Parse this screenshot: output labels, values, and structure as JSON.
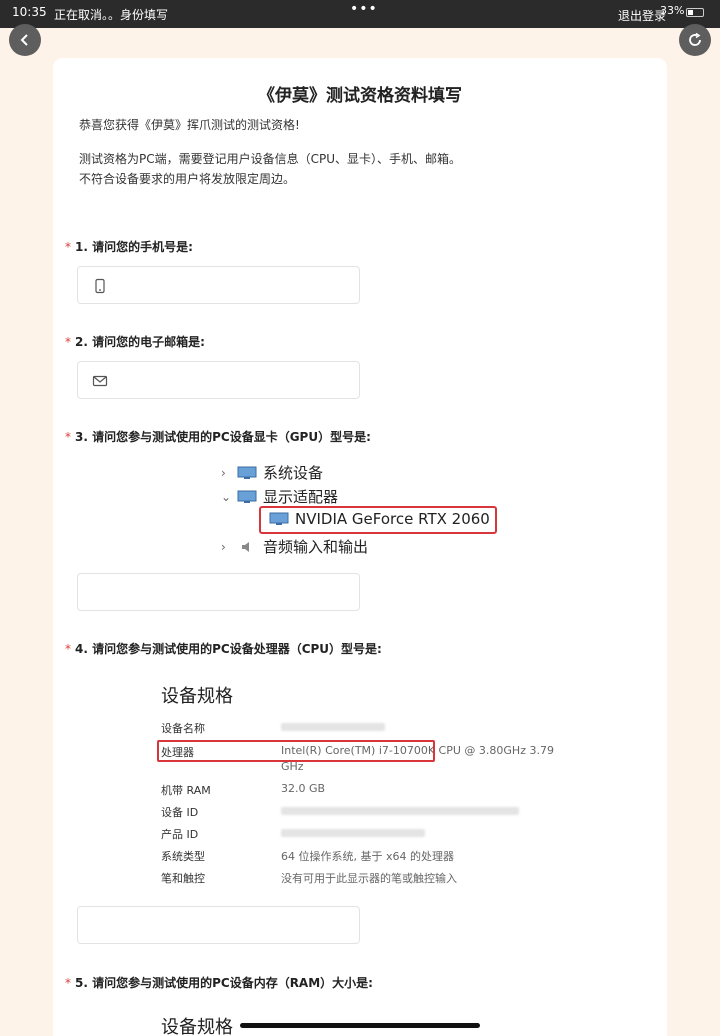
{
  "status_bar": {
    "time": "10:35",
    "tab_text": "正在取消。。身份填写",
    "dots": "•••",
    "logout": "退出登录",
    "battery": "33%"
  },
  "form": {
    "title": "《伊莫》测试资格资料填写",
    "intro_line1": "恭喜您获得《伊莫》挥爪测试的测试资格!",
    "intro_line2": "测试资格为PC端，需要登记用户设备信息（CPU、显卡）、手机、邮箱。",
    "intro_line3": "不符合设备要求的用户将发放限定周边。",
    "required_mark": "*",
    "questions": [
      {
        "label": "1. 请问您的手机号是:"
      },
      {
        "label": "2. 请问您的电子邮箱是:"
      },
      {
        "label": "3. 请问您参与测试使用的PC设备显卡（GPU）型号是:"
      },
      {
        "label": "4. 请问您参与测试使用的PC设备处理器（CPU）型号是:"
      },
      {
        "label": "5. 请问您参与测试使用的PC设备内存（RAM）大小是:"
      }
    ]
  },
  "gpu_image": {
    "row1": "系统设备",
    "row2": "显示适配器",
    "row3": "NVIDIA GeForce RTX 2060",
    "row4": "音频输入和输出",
    "chevron_right": "›",
    "chevron_down": "⌄"
  },
  "spec_image": {
    "title": "设备规格",
    "rows": [
      {
        "key": "设备名称",
        "value": ""
      },
      {
        "key": "处理器",
        "value": "Intel(R) Core(TM) i7-10700K CPU @ 3.80GHz   3.79"
      },
      {
        "key": "",
        "value": "GHz"
      },
      {
        "key": "机带 RAM",
        "value": "32.0 GB"
      },
      {
        "key": "设备 ID",
        "value": ""
      },
      {
        "key": "产品 ID",
        "value": ""
      },
      {
        "key": "系统类型",
        "value": "64 位操作系统, 基于 x64 的处理器"
      },
      {
        "key": "笔和触控",
        "value": "没有可用于此显示器的笔或触控输入"
      }
    ],
    "title2": "设备规格"
  },
  "colors": {
    "background": "#fdf3e8",
    "required": "#e23b3b",
    "highlight_box": "#d8363b"
  }
}
